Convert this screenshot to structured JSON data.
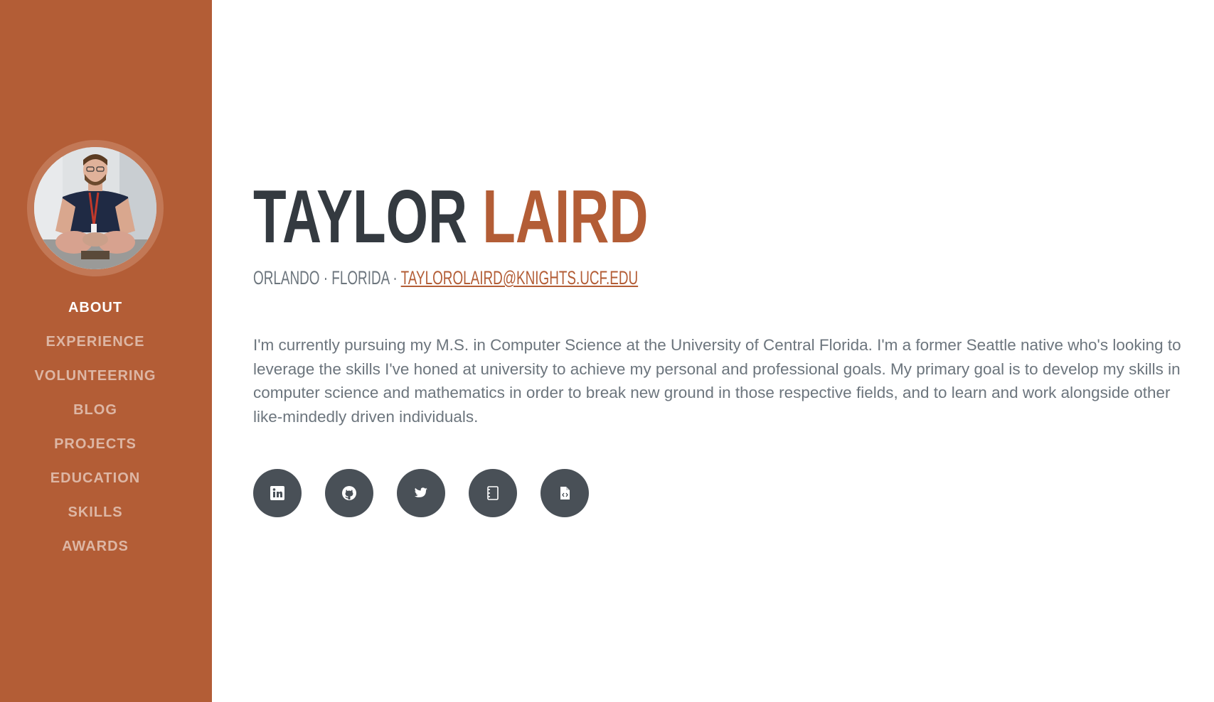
{
  "profile": {
    "first_name": "TAYLOR",
    "last_name": "LAIRD",
    "city": "ORLANDO",
    "separator": "·",
    "state": "FLORIDA",
    "email": "TAYLOROLAIRD@KNIGHTS.UCF.EDU",
    "bio": "I'm currently pursuing my M.S. in Computer Science at the University of Central Florida. I'm a former Seattle native who's looking to leverage the skills I've honed at university to achieve my personal and professional goals. My primary goal is to develop my skills in computer science and mathematics in order to break new ground in those respective fields, and to learn and work alongside other like-mindedly driven individuals."
  },
  "sidebar": {
    "nav": [
      {
        "label": "ABOUT",
        "active": true
      },
      {
        "label": "EXPERIENCE",
        "active": false
      },
      {
        "label": "VOLUNTEERING",
        "active": false
      },
      {
        "label": "BLOG",
        "active": false
      },
      {
        "label": "PROJECTS",
        "active": false
      },
      {
        "label": "EDUCATION",
        "active": false
      },
      {
        "label": "SKILLS",
        "active": false
      },
      {
        "label": "AWARDS",
        "active": false
      }
    ]
  },
  "social": [
    {
      "icon": "linkedin-icon"
    },
    {
      "icon": "github-icon"
    },
    {
      "icon": "twitter-icon"
    },
    {
      "icon": "notebook-icon"
    },
    {
      "icon": "code-file-icon"
    }
  ],
  "colors": {
    "primary": "#b35d36",
    "dark": "#343a40",
    "muted": "#6c757d",
    "social_bg": "#495057"
  }
}
